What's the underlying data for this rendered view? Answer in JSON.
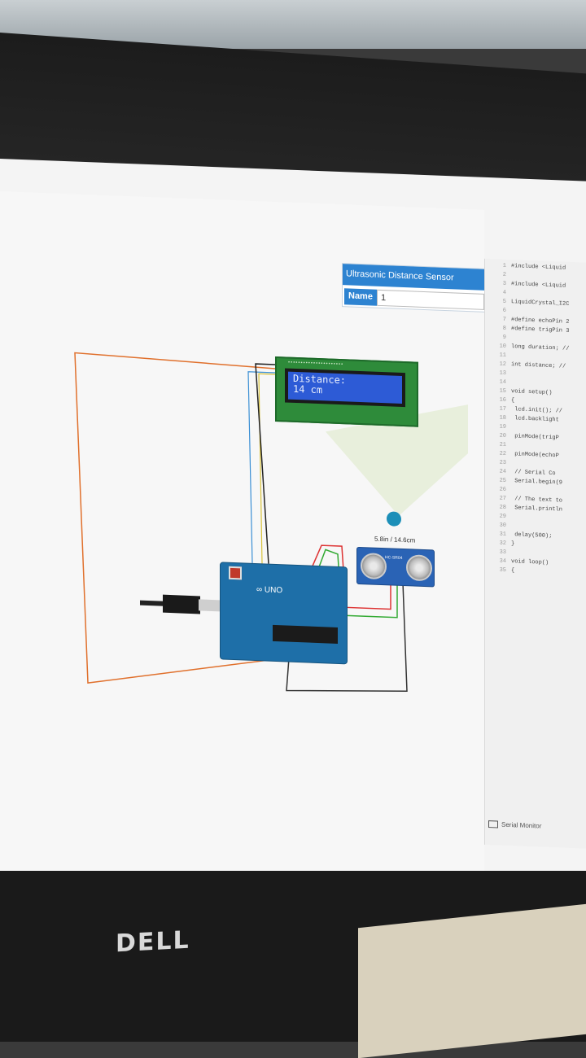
{
  "panel": {
    "title": "Ultrasonic Distance Sensor",
    "name_label": "Name",
    "name_value": "1"
  },
  "lcd": {
    "line1": "Distance:",
    "line2": "14  cm"
  },
  "sensor": {
    "readout": "5.8in / 14.6cm",
    "model_label": "HC-SR04"
  },
  "arduino": {
    "logo": "UNO"
  },
  "code_lines": [
    {
      "n": "1",
      "t": "#include <Liquid"
    },
    {
      "n": "2",
      "t": ""
    },
    {
      "n": "3",
      "t": "#include <Liquid"
    },
    {
      "n": "4",
      "t": ""
    },
    {
      "n": "5",
      "t": "LiquidCrystal_I2C"
    },
    {
      "n": "6",
      "t": ""
    },
    {
      "n": "7",
      "t": "#define echoPin 2"
    },
    {
      "n": "8",
      "t": "#define trigPin 3"
    },
    {
      "n": "9",
      "t": ""
    },
    {
      "n": "10",
      "t": "long duration; //"
    },
    {
      "n": "11",
      "t": ""
    },
    {
      "n": "12",
      "t": "int distance; //"
    },
    {
      "n": "13",
      "t": ""
    },
    {
      "n": "14",
      "t": ""
    },
    {
      "n": "15",
      "t": "void setup()"
    },
    {
      "n": "16",
      "t": "{"
    },
    {
      "n": "17",
      "t": "   lcd.init(); //"
    },
    {
      "n": "18",
      "t": "   lcd.backlight"
    },
    {
      "n": "19",
      "t": ""
    },
    {
      "n": "20",
      "t": "   pinMode(trigP"
    },
    {
      "n": "21",
      "t": ""
    },
    {
      "n": "22",
      "t": "   pinMode(echoP"
    },
    {
      "n": "23",
      "t": ""
    },
    {
      "n": "24",
      "t": "    // Serial Co"
    },
    {
      "n": "25",
      "t": "   Serial.begin(9"
    },
    {
      "n": "26",
      "t": ""
    },
    {
      "n": "27",
      "t": "   // The text to"
    },
    {
      "n": "28",
      "t": "   Serial.println"
    },
    {
      "n": "29",
      "t": ""
    },
    {
      "n": "30",
      "t": ""
    },
    {
      "n": "31",
      "t": "   delay(500);"
    },
    {
      "n": "32",
      "t": "}"
    },
    {
      "n": "33",
      "t": ""
    },
    {
      "n": "34",
      "t": "void loop()"
    },
    {
      "n": "35",
      "t": "{"
    }
  ],
  "serial_monitor": "Serial Monitor",
  "brand": "DELL"
}
